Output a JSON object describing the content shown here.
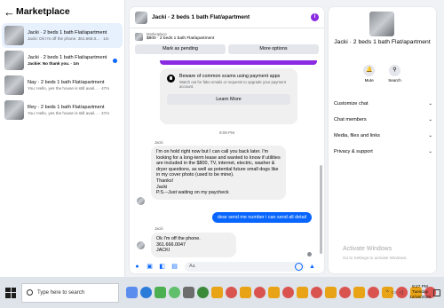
{
  "left": {
    "title": "Marketplace",
    "conversations": [
      {
        "title": "Jacki · 2 beds 1 bath Flat/apartment",
        "sub": "Jacki: Ok I'm off the phone. 361.666.0...",
        "time": "1m",
        "active": true,
        "unread": false
      },
      {
        "title": "Jacki · 2 beds 1 bath Flat/apartment",
        "sub": "Jackie: No thank you.",
        "time": "1m",
        "active": false,
        "unread": true
      },
      {
        "title": "Nay · 2 beds 1 bath Flat/apartment",
        "sub": "You: Hello, yes the house is still avail...",
        "time": "47m",
        "active": false,
        "unread": false
      },
      {
        "title": "Rey · 2 beds 1 bath Flat/apartment",
        "sub": "You: Hello, yes the house is still avail...",
        "time": "47m",
        "active": false,
        "unread": false
      }
    ]
  },
  "chat": {
    "header_title": "Jacki · 2 beds 1 bath Flat/apartment",
    "info_glyph": "i",
    "marketplace_label": "Marketplace",
    "listing": "$800 · 2 beds 1 bath Flat/apartment",
    "mark_pending": "Mark as pending",
    "more_options": "More options",
    "warning": {
      "title": "Beware of common scams using payment apps",
      "desc": "Watch out for fake emails or requests to upgrade your payment account.",
      "learn_more": "Learn More"
    },
    "timestamp": "9:08 PM",
    "msg1_sender": "Jacki",
    "msg1": "I'm on hold right now but I can call you back later. I'm looking for a long-term lease and wanted to know if utilities are included in the $800, TV, internet, electric, washer & dryer questions, as well as potential future small dogs like in my cover photo (used to be mine).\nThanks!\nJacki\nP.S.--Just waiting on my paycheck",
    "out_msg": "dear send me number i can send all detail",
    "msg2_sender": "Jacki",
    "msg2": "Ok I'm off the phone. 361.666.0047\nJACKI",
    "composer_placeholder": "Aa"
  },
  "right": {
    "title": "Jacki · 2 beds 1 bath Flat/apartment",
    "actions": [
      {
        "label": "Mute",
        "icon": "bell-icon"
      },
      {
        "label": "Search",
        "icon": "search-icon"
      }
    ],
    "menu": [
      "Customize chat",
      "Chat members",
      "Media, files and links",
      "Privacy & support"
    ],
    "activate_title": "Activate Windows",
    "activate_sub": "Go to Settings to activate Windows."
  },
  "taskbar": {
    "search_placeholder": "Type here to search",
    "time": "9:27 PM",
    "day": "Tuesday",
    "date": "12/16/2025",
    "icon_colors": [
      "#5b8def",
      "#2b7bd9",
      "#4caf50",
      "#5fbf6a",
      "#6d6d6d",
      "#3a8a3a",
      "#e8a317",
      "#d9534f",
      "#e8a317",
      "#d9534f",
      "#e8a317",
      "#d9534f",
      "#e8a317",
      "#d9534f",
      "#e8a317",
      "#d9534f",
      "#e8a317",
      "#d9534f",
      "#e8a317",
      "#d9534f",
      "#e8a317",
      "#d9534f"
    ]
  },
  "colors": {
    "accent": "#0866ff",
    "purple": "#8a2be2",
    "bubble_in": "#f0f0f0"
  }
}
